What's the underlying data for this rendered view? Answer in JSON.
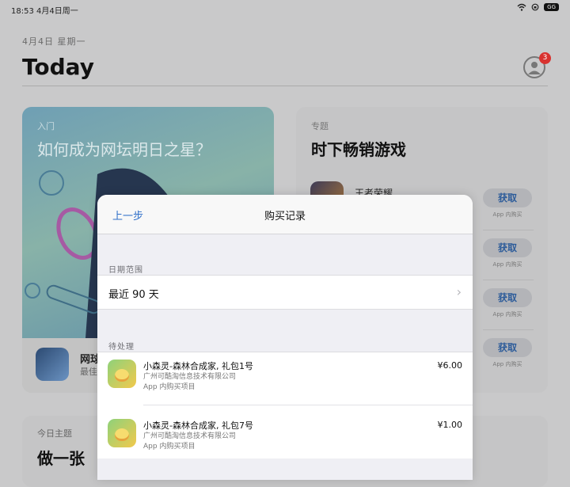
{
  "status_bar": {
    "time_date": "18:53  4月4日周一",
    "battery": "GG"
  },
  "header": {
    "date": "4月4日 星期一",
    "title": "Today",
    "badge_count": "3"
  },
  "card_left": {
    "kicker": "入门",
    "title": "如何成为网坛明日之星？",
    "app_name": "网球",
    "app_sub": "最佳"
  },
  "card_right": {
    "kicker": "专题",
    "title": "时下畅销游戏",
    "first_game": "王者荣耀",
    "get_label": "获取",
    "iap_label": "App 内购买"
  },
  "card_bottom": {
    "kicker": "今日主题",
    "title": "做一张"
  },
  "modal": {
    "back_label": "上一步",
    "title": "购买记录",
    "date_range_section": "日期范围",
    "date_range_value": "最近 90 天",
    "pending_section": "待处理",
    "items": [
      {
        "title": "小森灵-森林合成家, 礼包1号",
        "developer": "广州可酷淘信息技术有限公司",
        "type": "App 内购买项目",
        "price": "¥6.00"
      },
      {
        "title": "小森灵-森林合成家, 礼包7号",
        "developer": "广州可酷淘信息技术有限公司",
        "type": "App 内购买项目",
        "price": "¥1.00"
      }
    ]
  },
  "colors": {
    "link_blue": "#2f6fc9",
    "badge_red": "#d8322f",
    "dim_overlay": "#c9c9ca"
  }
}
